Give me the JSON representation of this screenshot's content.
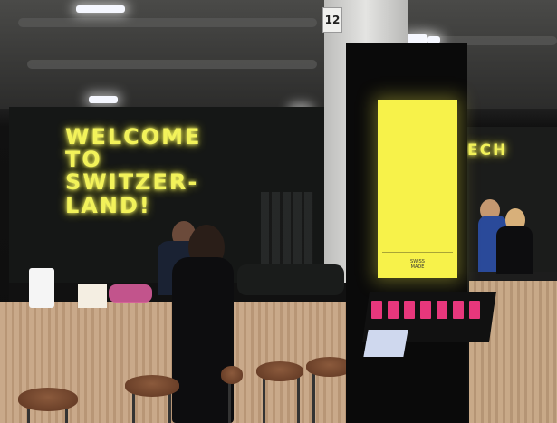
{
  "scene": {
    "neon_sign_main": "WELCOME\nTO\nSWITZER-\nLAND!",
    "neon_sign_side": "ECH",
    "pillar_number": "12",
    "kiosk_screen_brand": "SWISS\nMADE"
  },
  "colors": {
    "neon": "#f2f25a",
    "kiosk_screen": "#f7f24a",
    "counter_wood": "#c9a98a",
    "wall": "#151716",
    "book_pink": "#e8377c"
  }
}
